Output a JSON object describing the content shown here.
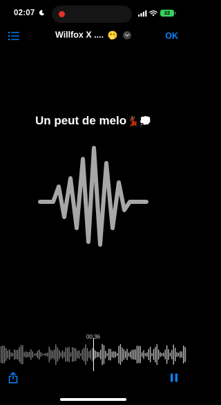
{
  "status": {
    "time": "02:07",
    "battery": "22",
    "recording": true
  },
  "nav": {
    "title": "Willfox X ....",
    "title_emoji": "🫢",
    "ok_label": "OK"
  },
  "main": {
    "track_title": "Un peut de melo",
    "track_emoji": "💃🏾💭"
  },
  "playback": {
    "elapsed": "00:36",
    "state": "playing"
  },
  "icons": {
    "moon": "moon-icon",
    "signal": "signal-icon",
    "wifi": "wifi-icon",
    "list": "list-icon",
    "chevron": "chevron-down-icon",
    "waveform": "waveform-icon",
    "share": "share-icon",
    "pause": "pause-icon"
  },
  "colors": {
    "accent": "#0a84ff",
    "record": "#e4312b",
    "battery": "#37d15c",
    "waveform": "#a7a7a7",
    "background": "#000000"
  }
}
